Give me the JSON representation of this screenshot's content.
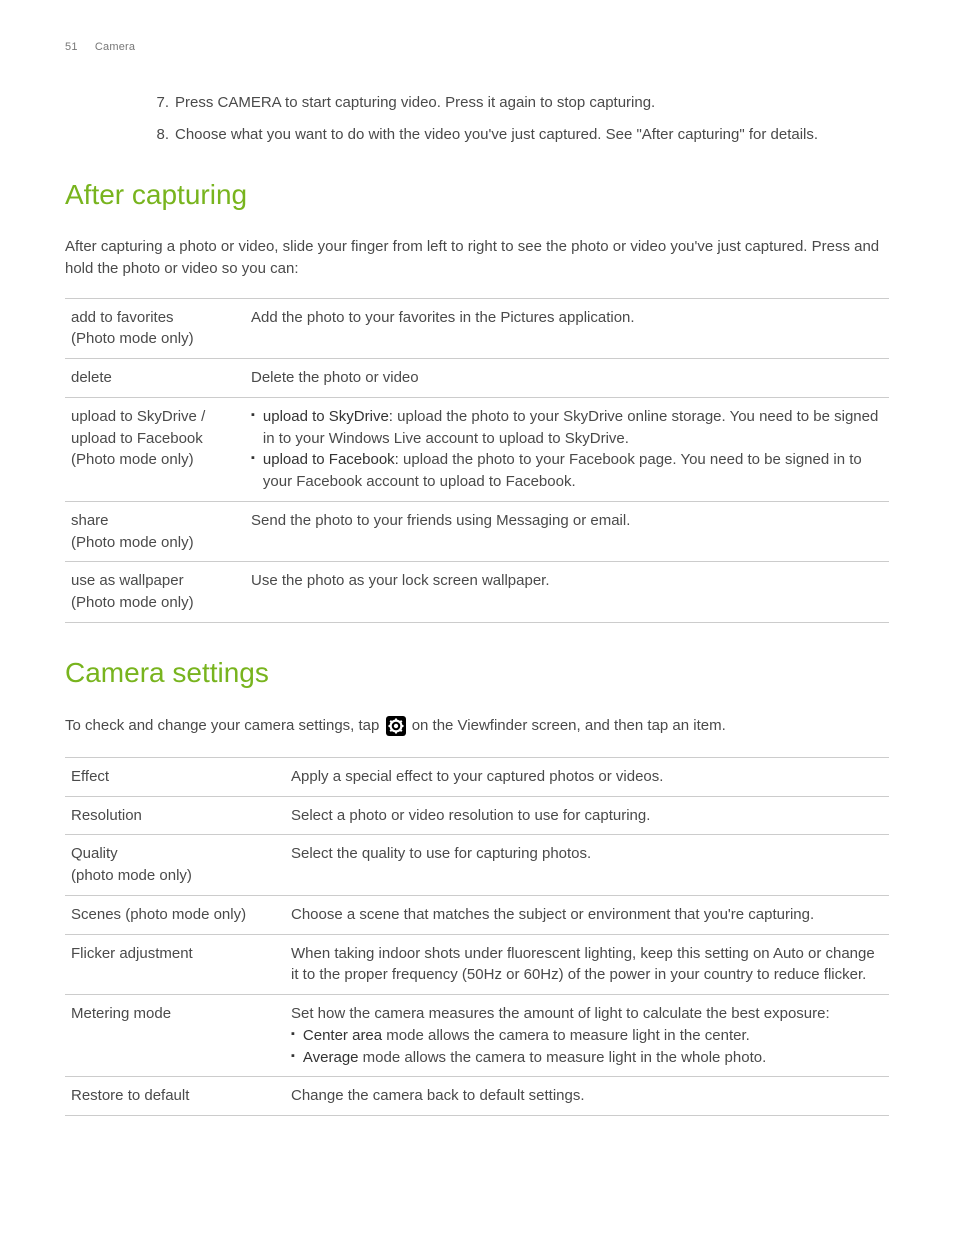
{
  "header": {
    "page": "51",
    "section": "Camera"
  },
  "steps": [
    {
      "n": "7.",
      "t": "Press CAMERA to start capturing video. Press it again to stop capturing."
    },
    {
      "n": "8.",
      "t": "Choose what you want to do with the video you've just captured. See \"After capturing\" for details."
    }
  ],
  "after": {
    "title": "After capturing",
    "intro": "After capturing a photo or video, slide your finger from left to right to see the photo or video you've just captured. Press and hold the photo or video so you can:",
    "rows": [
      {
        "left1": "add to favorites",
        "left2": "(Photo mode only)",
        "right": "Add the photo to your favorites in the Pictures application."
      },
      {
        "left1": "delete",
        "right": "Delete the photo or video"
      },
      {
        "left1": "upload to SkyDrive /",
        "left2": "upload to Facebook",
        "left3": "(Photo mode only)",
        "bullets": [
          {
            "b": "upload to SkyDrive:",
            "t": " upload the photo to your SkyDrive online storage. You need to be signed in to your Windows Live account to upload to SkyDrive."
          },
          {
            "b": "upload to Facebook:",
            "t": " upload the photo to your Facebook page. You need to be signed in to your Facebook account to upload to Facebook."
          }
        ]
      },
      {
        "left1": "share",
        "left2": "(Photo mode only)",
        "right": "Send the photo to your friends using Messaging or email."
      },
      {
        "left1": "use as wallpaper",
        "left2": "(Photo mode only)",
        "right": "Use the photo as your lock screen wallpaper."
      }
    ]
  },
  "settings": {
    "title": "Camera settings",
    "intro1": "To check and change your camera settings, tap ",
    "intro2": " on the Viewfinder screen, and then tap an item.",
    "rows": [
      {
        "l": "Effect",
        "r": "Apply a special effect to your captured photos or videos."
      },
      {
        "l": "Resolution",
        "r": "Select a photo or video resolution to use for capturing."
      },
      {
        "l": "Quality",
        "l2": "(photo mode only)",
        "r": "Select the quality to use for capturing photos."
      },
      {
        "l": "Scenes (photo mode only)",
        "r": "Choose a scene that matches the subject or environment that you're capturing."
      },
      {
        "l": "Flicker adjustment",
        "r": "When taking indoor shots under fluorescent lighting, keep this setting on Auto or change it to the proper frequency (50Hz or 60Hz) of the power in your country to reduce flicker."
      },
      {
        "l": "Metering mode",
        "r_intro": "Set how the camera measures the amount of light to calculate the best exposure:",
        "bullets": [
          {
            "b": "Center area",
            "t": " mode allows the camera to measure light in the center."
          },
          {
            "b": "Average",
            "t": " mode allows the camera to measure light in the whole photo."
          }
        ]
      },
      {
        "l": "Restore to default",
        "r": "Change the camera back to default settings."
      }
    ]
  }
}
